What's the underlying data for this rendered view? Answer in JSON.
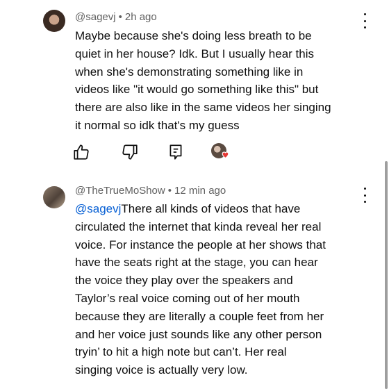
{
  "comments": [
    {
      "author": "@sagevj",
      "time": "2h ago",
      "lines": [
        "Maybe because she's doing less breath to be",
        "quiet in her house? Idk. But I usually hear this",
        "when she's demonstrating something like in",
        "videos like \"it would go something like this\" but",
        "there are also like in the same videos her singing",
        "it normal so idk that's my guess"
      ]
    },
    {
      "author": "@TheTrueMoShow",
      "time": "12 min ago",
      "mention": "@sagevj",
      "first_line_rest": "There all kinds of videos that have",
      "lines": [
        "circulated the internet that kinda reveal her real",
        "voice. For instance the people at her shows that",
        "have the seats right at the stage, you can hear",
        "the voice they play over the speakers and",
        "Taylor’s real voice coming out of her mouth",
        "because they are literally a couple feet from her",
        "and her voice just sounds like any other person",
        "tryin’ to hit a high note but can’t. Her real",
        "singing voice is actually very low."
      ]
    }
  ],
  "actions": {
    "icons": [
      "like-icon",
      "dislike-icon",
      "reply-icon",
      "creator-heart-icon"
    ]
  },
  "colors": {
    "text": "#0f0f0f",
    "meta": "#606060",
    "mention": "#065fd4",
    "heart": "#e53935"
  }
}
